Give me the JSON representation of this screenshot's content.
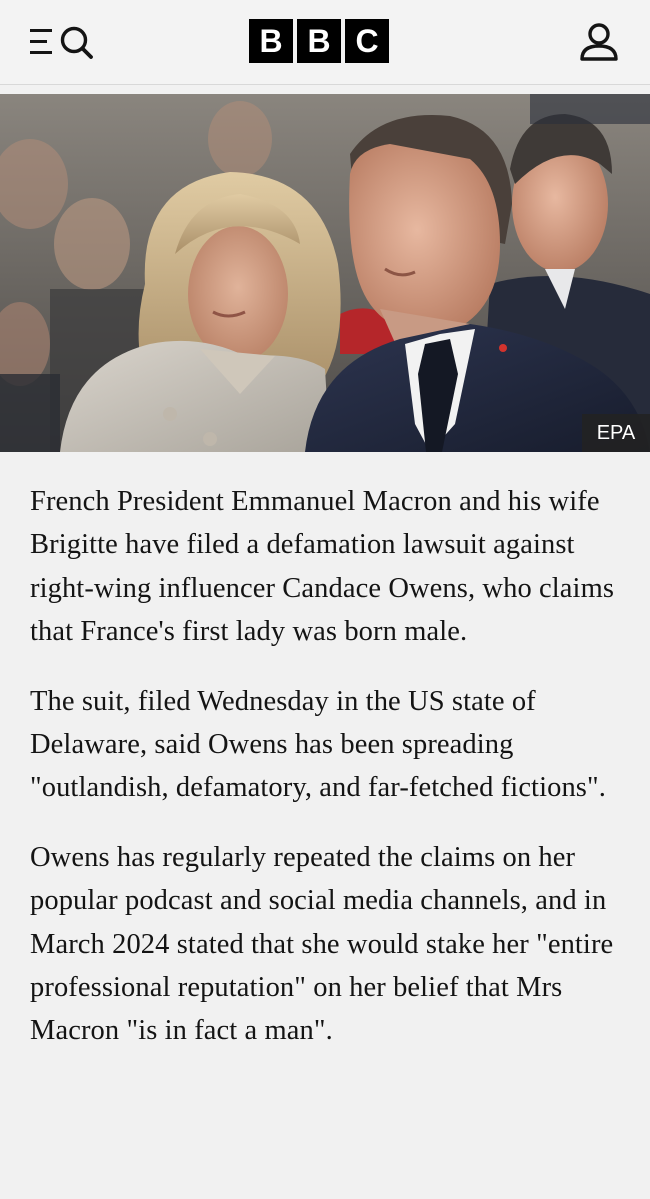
{
  "header": {
    "logo_letters": [
      "B",
      "B",
      "C"
    ],
    "menu_icon": "menu-search-icon",
    "account_icon": "account-icon"
  },
  "hero": {
    "credit": "EPA"
  },
  "article": {
    "paragraphs": [
      "French President Emmanuel Macron and his wife Brigitte have filed a defamation lawsuit against right-wing influencer Candace Owens, who claims that France's first lady was born male.",
      "The suit, filed Wednesday in the US state of Delaware, said Owens has been spreading \"outlandish, defamatory, and far-fetched fictions\".",
      "Owens has regularly repeated the claims on her popular podcast and social media channels, and in March 2024 stated that she would stake her \"entire professional reputation\" on her belief that Mrs Macron \"is in fact a man\"."
    ]
  },
  "colors": {
    "background": "#f1f1f1",
    "text": "#141414",
    "logo": "#000000",
    "credit_bg": "#222222"
  }
}
